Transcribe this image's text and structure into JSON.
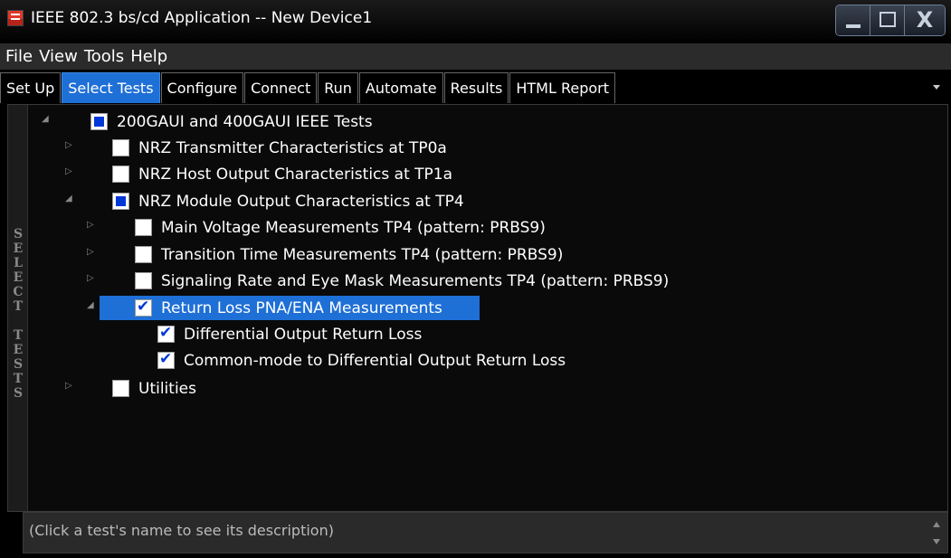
{
  "window": {
    "title": "IEEE 802.3 bs/cd Application -- New Device1"
  },
  "menu": [
    "File",
    "View",
    "Tools",
    "Help"
  ],
  "tabs": [
    "Set Up",
    "Select Tests",
    "Configure",
    "Connect",
    "Run",
    "Automate",
    "Results",
    "HTML Report"
  ],
  "active_tab": "Select Tests",
  "side_label": [
    "S",
    "E",
    "L",
    "E",
    "C",
    "T",
    "",
    "T",
    "E",
    "S",
    "T",
    "S"
  ],
  "tree": [
    {
      "label": "200GAUI and 400GAUI IEEE Tests",
      "state": "partial",
      "expanded": true
    },
    {
      "label": "NRZ Transmitter Characteristics at TP0a",
      "state": "unchecked",
      "expanded": false
    },
    {
      "label": "NRZ Host Output Characteristics at TP1a",
      "state": "unchecked",
      "expanded": false
    },
    {
      "label": "NRZ Module Output Characteristics at TP4",
      "state": "partial",
      "expanded": true
    },
    {
      "label": "Main Voltage Measurements TP4 (pattern: PRBS9)",
      "state": "unchecked",
      "expanded": false
    },
    {
      "label": "Transition Time Measurements TP4 (pattern: PRBS9)",
      "state": "unchecked",
      "expanded": false
    },
    {
      "label": "Signaling Rate and Eye Mask Measurements TP4 (pattern: PRBS9)",
      "state": "unchecked",
      "expanded": false
    },
    {
      "label": "Return Loss PNA/ENA Measurements",
      "state": "checked",
      "expanded": true,
      "selected": true
    },
    {
      "label": "Differential Output Return Loss",
      "state": "checked"
    },
    {
      "label": "Common-mode to Differential Output Return Loss",
      "state": "checked"
    },
    {
      "label": "Utilities",
      "state": "unchecked",
      "expanded": false
    }
  ],
  "description": "(Click a test's name to see its description)",
  "colors": {
    "accent": "#1e6fd6",
    "check": "#0038d8"
  }
}
